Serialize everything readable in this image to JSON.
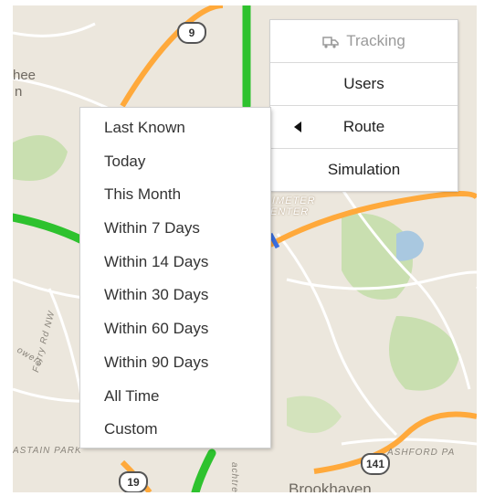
{
  "map": {
    "labels": {
      "town_left": "hee",
      "town_left_2": "n",
      "perimeter_1": "IMETER",
      "perimeter_2": "ENTER",
      "ferry": "Ferry Rd NW",
      "towers": "owers",
      "bastain": "ASTAIN PARK",
      "ashford": "ASHFORD PA",
      "brookhaven": "Brookhaven",
      "peachtree": "achtree"
    },
    "shields": {
      "r9": "9",
      "r141": "141",
      "r19": "19"
    },
    "colors": {
      "land": "#ece7dd",
      "highway": "#ffa93b",
      "park": "#c9dfb0",
      "traffic": "#2ec22e"
    }
  },
  "menu": {
    "tracking_label": "Tracking",
    "tracking_icon": "truck-icon",
    "users_label": "Users",
    "route_label": "Route",
    "simulation_label": "Simulation"
  },
  "dropdown": {
    "items": [
      "Last Known",
      "Today",
      "This Month",
      "Within 7 Days",
      "Within 14 Days",
      "Within 30 Days",
      "Within 60 Days",
      "Within 90 Days",
      "All Time",
      "Custom"
    ]
  }
}
